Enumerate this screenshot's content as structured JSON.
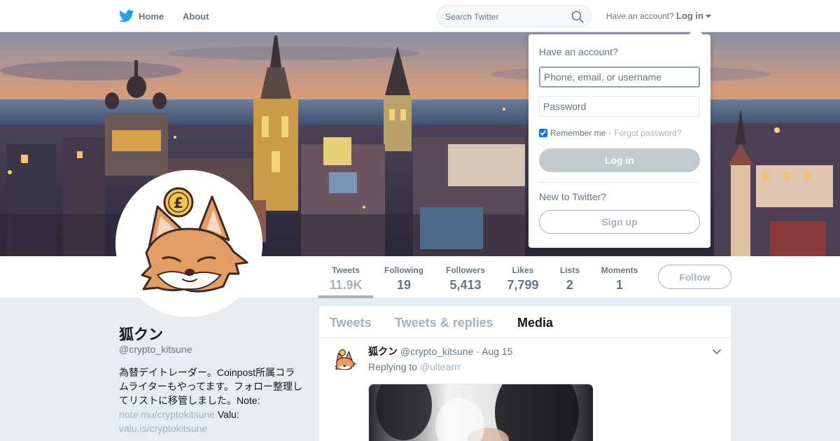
{
  "colors": {
    "accent": "#a5b2bd",
    "twitter_blue": "#1da1f2",
    "background": "#e6ecf0",
    "text_primary": "#14171a",
    "text_secondary": "#657786"
  },
  "nav": {
    "logo_icon": "twitter-bird-icon",
    "home_icon": "twitter-bird-icon",
    "home_label": "Home",
    "about_label": "About",
    "search_placeholder": "Search Twitter",
    "search_icon": "search-icon",
    "have_account_text": "Have an account?",
    "login_label": "Log in"
  },
  "login_dropdown": {
    "title": "Have an account?",
    "username_placeholder": "Phone, email, or username",
    "password_placeholder": "Password",
    "remember_checked": true,
    "remember_label": "Remember me",
    "separator": "·",
    "forgot_label": "Forgot password?",
    "login_button": "Log in",
    "new_text": "New to Twitter?",
    "signup_button": "Sign up"
  },
  "profile_nav": {
    "stats": [
      {
        "label": "Tweets",
        "value": "11.9K"
      },
      {
        "label": "Following",
        "value": "19"
      },
      {
        "label": "Followers",
        "value": "5,413"
      },
      {
        "label": "Likes",
        "value": "7,799"
      },
      {
        "label": "Lists",
        "value": "2"
      },
      {
        "label": "Moments",
        "value": "1"
      }
    ],
    "follow_button": "Follow"
  },
  "profile": {
    "name": "狐クン",
    "handle": "@crypto_kitsune",
    "bio_text": "為替デイトレーダー。Coinpost所属コラムライターもやってます。フォロー整理してリストに移管しました。Note: ",
    "bio_link1": "note.mu/cryptokitsune",
    "bio_mid": " Valu: ",
    "bio_link2": "valu.is/cryptokitsune"
  },
  "timeline": {
    "tabs": [
      {
        "label": "Tweets"
      },
      {
        "label": "Tweets & replies"
      },
      {
        "label": "Media"
      }
    ],
    "active_tab": "Media",
    "tweet": {
      "name": "狐クン",
      "handle": "@crypto_kitsune",
      "separator": "·",
      "time": "Aug 15",
      "replying_prefix": "Replying to ",
      "replying_to": "@ultearrr"
    }
  }
}
